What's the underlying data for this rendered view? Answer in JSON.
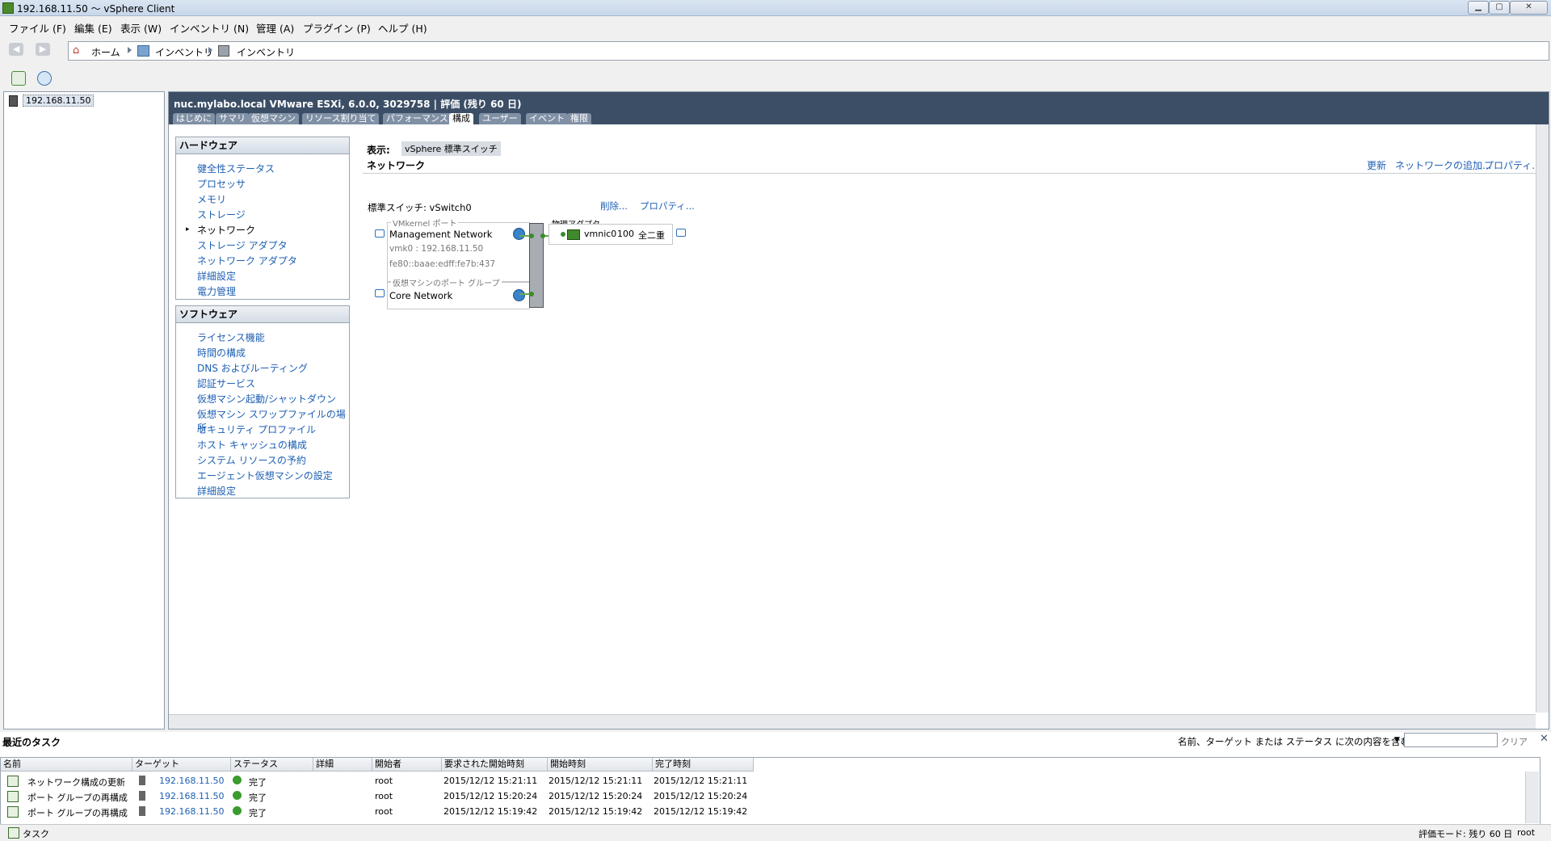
{
  "window": {
    "title": "192.168.11.50 ～ vSphere Client"
  },
  "menu": [
    "ファイル (F)",
    "編集 (E)",
    "表示 (W)",
    "インベントリ (N)",
    "管理 (A)",
    "プラグイン (P)",
    "ヘルプ (H)"
  ],
  "breadcrumb": [
    "ホーム",
    "インベントリ",
    "インベントリ"
  ],
  "inventory": {
    "host": "192.168.11.50"
  },
  "host_header": {
    "title": "nuc.mylabo.local VMware ESXi, 6.0.0, 3029758 | 評価 (残り 60 日)"
  },
  "tabs": [
    "はじめに",
    "サマリ",
    "仮想マシン",
    "リソース割り当て",
    "パフォーマンス",
    "構成",
    "ユーザー",
    "イベント",
    "権限"
  ],
  "hardware": {
    "title": "ハードウェア",
    "items": [
      "健全性ステータス",
      "プロセッサ",
      "メモリ",
      "ストレージ",
      "ネットワーク",
      "ストレージ アダプタ",
      "ネットワーク アダプタ",
      "詳細設定",
      "電力管理"
    ]
  },
  "software": {
    "title": "ソフトウェア",
    "items": [
      "ライセンス機能",
      "時間の構成",
      "DNS およびルーティング",
      "認証サービス",
      "仮想マシン起動/シャットダウン",
      "仮想マシン スワップファイルの場所",
      "セキュリティ プロファイル",
      "ホスト キャッシュの構成",
      "システム リソースの予約",
      "エージェント仮想マシンの設定",
      "詳細設定"
    ]
  },
  "network": {
    "view_label": "表示:",
    "view_value": "vSphere 標準スイッチ",
    "section_title": "ネットワーク",
    "actions": [
      "更新",
      "ネットワークの追加...",
      "プロパティ..."
    ],
    "switch_label": "標準スイッチ: vSwitch0",
    "switch_actions": [
      "削除...",
      "プロパティ..."
    ],
    "vmkernel_group_label": "VMkernel ポート",
    "vmkernel_name": "Management Network",
    "vmk_ip": "vmk0 : 192.168.11.50",
    "vmk_ipv6": "fe80::baae:edff:fe7b:437",
    "vm_group_label": "仮想マシンのポート グループ",
    "vm_group_name": "Core Network",
    "adapter_label": "物理アダプタ",
    "adapter_name": "vmnic0",
    "adapter_speed": "100",
    "adapter_duplex": "全二重"
  },
  "tasks": {
    "title": "最近のタスク",
    "filter_label": "名前、ターゲット または ステータス に次の内容を含む:",
    "clear": "クリア",
    "columns": [
      "名前",
      "ターゲット",
      "ステータス",
      "詳細",
      "開始者",
      "要求された開始時刻",
      "開始時刻",
      "完了時刻"
    ],
    "rows": [
      {
        "name": "ネットワーク構成の更新",
        "target": "192.168.11.50",
        "status": "完了",
        "initiator": "root",
        "requested": "2015/12/12 15:21:11",
        "start": "2015/12/12 15:21:11",
        "end": "2015/12/12 15:21:11"
      },
      {
        "name": "ポート グループの再構成",
        "target": "192.168.11.50",
        "status": "完了",
        "initiator": "root",
        "requested": "2015/12/12 15:20:24",
        "start": "2015/12/12 15:20:24",
        "end": "2015/12/12 15:20:24"
      },
      {
        "name": "ポート グループの再構成",
        "target": "192.168.11.50",
        "status": "完了",
        "initiator": "root",
        "requested": "2015/12/12 15:19:42",
        "start": "2015/12/12 15:19:42",
        "end": "2015/12/12 15:19:42"
      }
    ]
  },
  "statusbar": {
    "tasks_label": "タスク",
    "eval": "評価モード: 残り 60 日",
    "user": "root"
  }
}
